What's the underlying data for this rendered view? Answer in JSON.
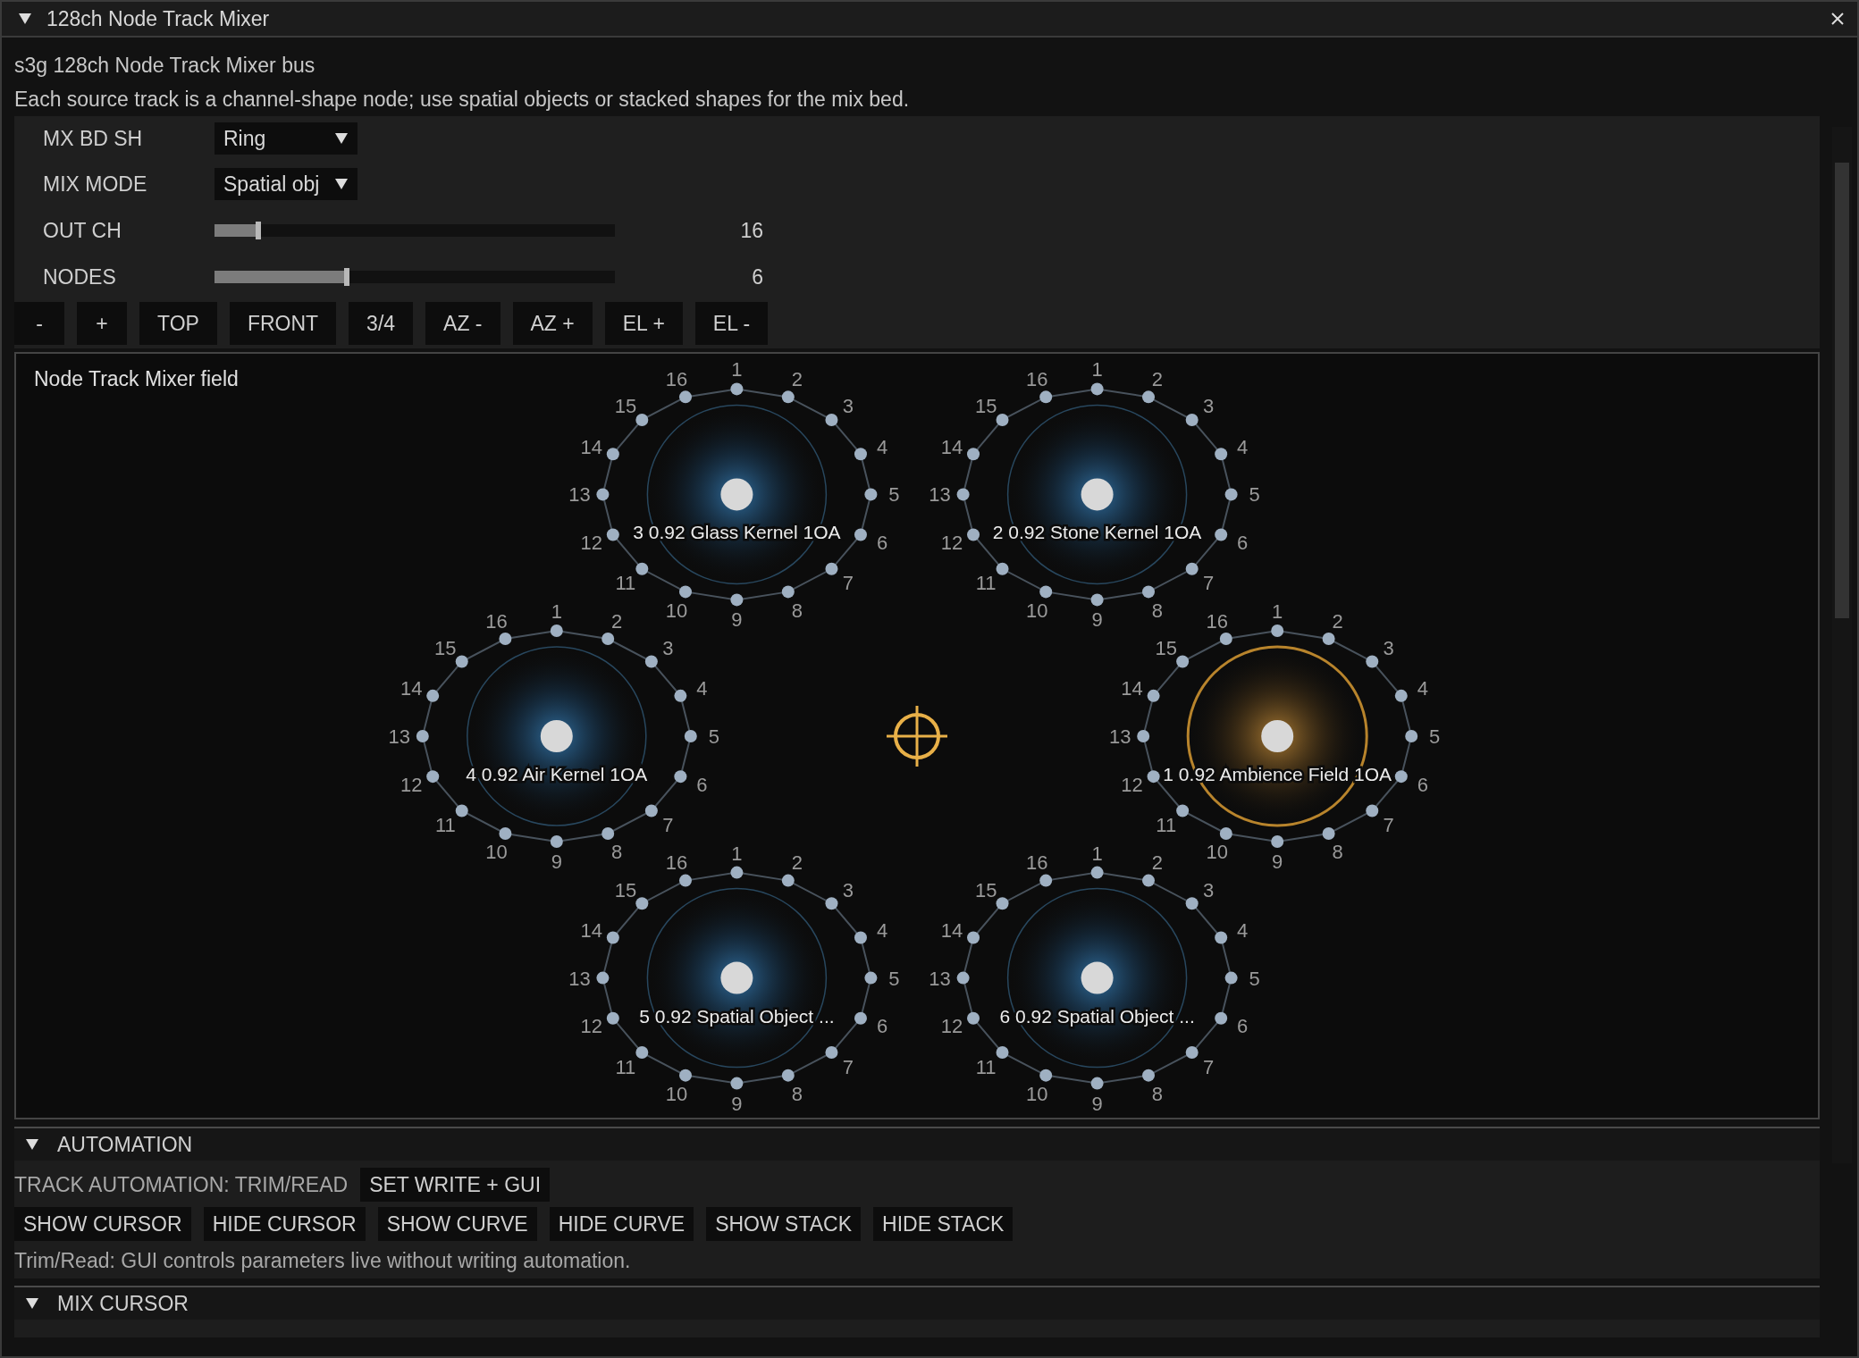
{
  "window": {
    "title": "128ch Node Track Mixer"
  },
  "subtitle": "s3g 128ch Node Track Mixer bus",
  "description": "Each source track is a channel-shape node; use spatial objects or stacked shapes for the mix bed.",
  "controls": [
    {
      "kind": "dropdown",
      "label": "MX BD SH",
      "value": "Ring"
    },
    {
      "kind": "dropdown",
      "label": "MIX MODE",
      "value": "Spatial obj"
    },
    {
      "kind": "slider",
      "label": "OUT CH",
      "level": 0.11,
      "reading": "16"
    },
    {
      "kind": "slider",
      "label": "NODES",
      "level": 0.33,
      "reading": "6"
    }
  ],
  "view_buttons": [
    "-",
    "+",
    "TOP",
    "FRONT",
    "3/4",
    "AZ -",
    "AZ +",
    "EL +",
    "EL -"
  ],
  "field": {
    "title": "Node Track Mixer field",
    "nodes": [
      {
        "label": "3 0.92 Glass Kernel 1OA",
        "selected": false,
        "channels": [
          "1",
          "2",
          "3",
          "4",
          "5",
          "6",
          "7",
          "8",
          "9",
          "10",
          "11",
          "12",
          "13",
          "14",
          "15",
          "16"
        ]
      },
      {
        "label": "2 0.92 Stone Kernel 1OA",
        "selected": false,
        "channels": [
          "1",
          "2",
          "3",
          "4",
          "5",
          "6",
          "7",
          "8",
          "9",
          "10",
          "11",
          "12",
          "13",
          "14",
          "15",
          "16"
        ]
      },
      {
        "label": "4 0.92 Air Kernel 1OA",
        "selected": false,
        "channels": [
          "1",
          "2",
          "3",
          "4",
          "5",
          "6",
          "7",
          "8",
          "9",
          "10",
          "11",
          "12",
          "13",
          "14",
          "15",
          "16"
        ]
      },
      {
        "label": "1 0.92 Ambience Field 1OA",
        "selected": true,
        "channels": [
          "1",
          "2",
          "3",
          "4",
          "5",
          "6",
          "7",
          "8",
          "9",
          "10",
          "11",
          "12",
          "13",
          "14",
          "15",
          "16"
        ]
      },
      {
        "label": "5 0.92 Spatial Object ...",
        "selected": false,
        "channels": [
          "1",
          "2",
          "3",
          "4",
          "5",
          "6",
          "7",
          "8",
          "9",
          "10",
          "11",
          "12",
          "13",
          "14",
          "15",
          "16"
        ]
      },
      {
        "label": "6 0.92 Spatial Object ...",
        "selected": false,
        "channels": [
          "1",
          "2",
          "3",
          "4",
          "5",
          "6",
          "7",
          "8",
          "9",
          "10",
          "11",
          "12",
          "13",
          "14",
          "15",
          "16"
        ]
      }
    ]
  },
  "automation": {
    "title": "AUTOMATION",
    "expanded": true,
    "status": "TRACK AUTOMATION: TRIM/READ",
    "write_button": "SET WRITE + GUI",
    "buttons": [
      "SHOW CURSOR",
      "HIDE CURSOR",
      "SHOW CURVE",
      "HIDE CURVE",
      "SHOW STACK",
      "HIDE STACK"
    ],
    "note": "Trim/Read: GUI controls parameters live without writing automation."
  },
  "mix_cursor": {
    "title": "MIX CURSOR",
    "expanded": true
  }
}
